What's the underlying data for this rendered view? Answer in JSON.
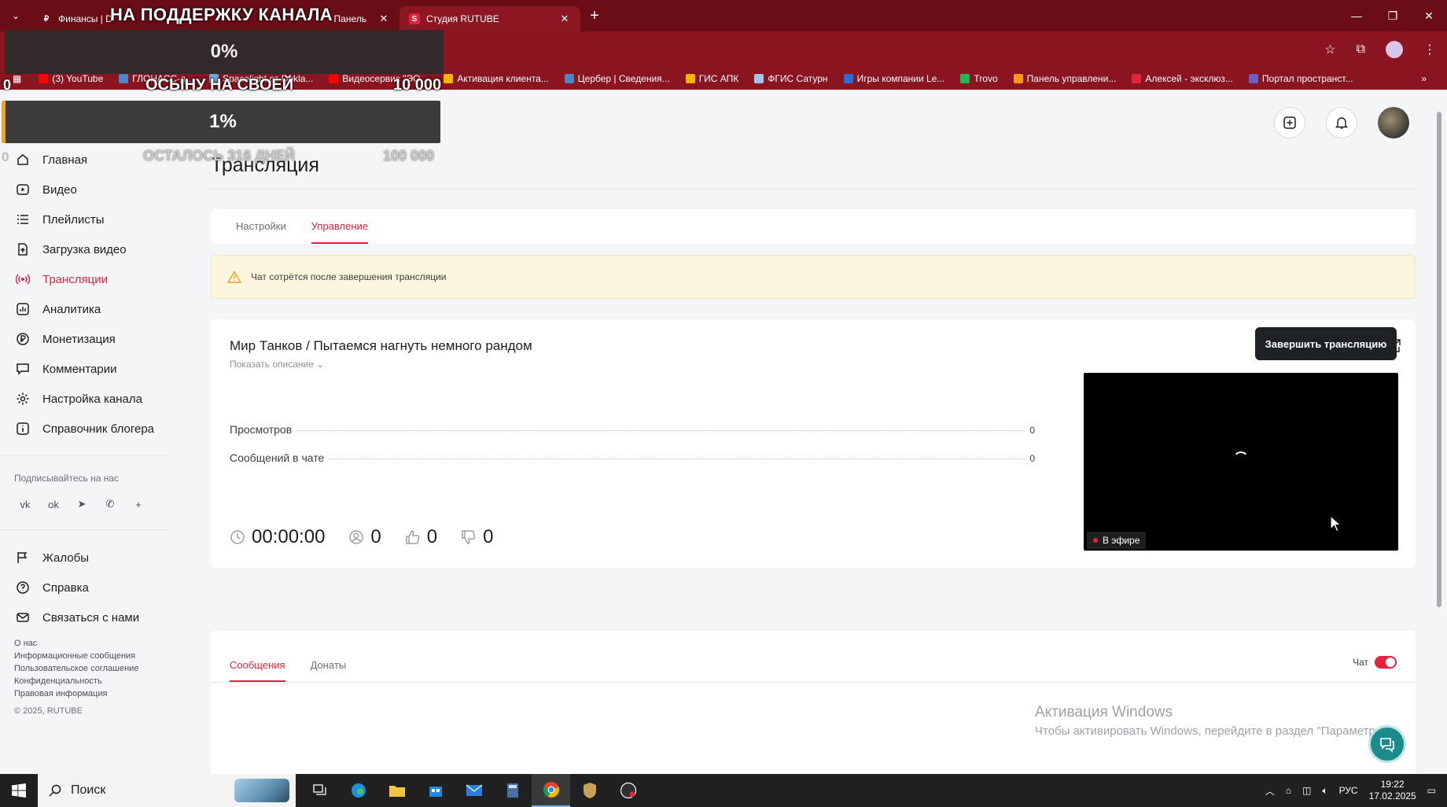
{
  "browser": {
    "tabs": [
      {
        "title": "Финансы | D",
        "title_tail": "Панель",
        "active": false
      },
      {
        "title": "Студия RUTUBE",
        "active": true
      }
    ],
    "new_tab": "+",
    "window_controls": [
      "—",
      "❐",
      "✕"
    ],
    "bookmarks": [
      {
        "label": "(3) YouTube",
        "color": "#ff0000"
      },
      {
        "label": "ГЛОНАСС-д...",
        "color": "#4a86c8"
      },
      {
        "label": "Spacelight от Dokla...",
        "color": "#6fa8dc"
      },
      {
        "label": "Видеосервис \"ЭО...",
        "color": "#ff0000"
      },
      {
        "label": "Активация клиента...",
        "color": "#f4b400"
      },
      {
        "label": "Цербер | Сведения...",
        "color": "#4a86c8"
      },
      {
        "label": "ГИС АПК",
        "color": "#f4b400"
      },
      {
        "label": "ФГИС Сатурн",
        "color": "#9fc5e8"
      },
      {
        "label": "Игры компании Le...",
        "color": "#2d6cdf"
      },
      {
        "label": "Trovo",
        "color": "#1db954"
      },
      {
        "label": "Панель управлени...",
        "color": "#f29b1d"
      },
      {
        "label": "Алексей - эксклюз...",
        "color": "#e2233e"
      },
      {
        "label": "Портал пространст...",
        "color": "#6d5ec9"
      }
    ],
    "bookmarks_more": "»"
  },
  "overlay": {
    "title": "НА ПОДДЕРЖКУ КАНАЛА",
    "goal1": {
      "percent": "0%",
      "min": "0",
      "subtitle": "ОСЫНУ НА СВОЕЙ",
      "max": "10 000",
      "progress": 0.0
    },
    "goal2": {
      "percent": "1%",
      "min": "0",
      "subtitle": "ОСТАЛОСЬ 316 ДНЕЙ",
      "max": "100 000",
      "progress": 0.01
    }
  },
  "sidebar": {
    "items": [
      {
        "label": "Главная",
        "icon": "home-icon",
        "active": false
      },
      {
        "label": "Видео",
        "icon": "video-icon",
        "active": false
      },
      {
        "label": "Плейлисты",
        "icon": "playlist-icon",
        "active": false
      },
      {
        "label": "Загрузка видео",
        "icon": "upload-icon",
        "active": false
      },
      {
        "label": "Трансляции",
        "icon": "broadcast-icon",
        "active": true
      },
      {
        "label": "Аналитика",
        "icon": "analytics-icon",
        "active": false
      },
      {
        "label": "Монетизация",
        "icon": "ruble-icon",
        "active": false
      },
      {
        "label": "Комментарии",
        "icon": "comment-icon",
        "active": false
      },
      {
        "label": "Настройка канала",
        "icon": "gear-icon",
        "active": false
      },
      {
        "label": "Справочник блогера",
        "icon": "info-icon",
        "active": false
      }
    ],
    "follow_label": "Подписывайтесь на нас",
    "socials": [
      "vk",
      "ok",
      "telegram",
      "viber",
      "more"
    ],
    "bottom_items": [
      {
        "label": "Жалобы",
        "icon": "flag-icon"
      },
      {
        "label": "Справка",
        "icon": "help-icon"
      },
      {
        "label": "Связаться с нами",
        "icon": "mail-icon"
      }
    ],
    "footer_links": [
      "О нас",
      "Информационные сообщения",
      "Пользовательское соглашение",
      "Конфиденциальность",
      "Правовая информация"
    ],
    "copyright": "© 2025, RUTUBE"
  },
  "page": {
    "title": "Трансляция",
    "tabs": [
      {
        "label": "Настройки",
        "active": false
      },
      {
        "label": "Управление",
        "active": true
      }
    ],
    "alert": "Чат сотрётся после завершения трансляции",
    "stream": {
      "title": "Мир Танков / Пытаемся нагнуть немного рандом",
      "show_description": "Показать описание",
      "stats": [
        {
          "label": "Просмотров",
          "value": "0"
        },
        {
          "label": "Сообщений в чате",
          "value": "0"
        }
      ],
      "duration": "00:00:00",
      "viewers": "0",
      "likes": "0",
      "dislikes": "0",
      "live_badge": "В эфире",
      "end_button": "Завершить трансляцию"
    },
    "chat": {
      "tabs": [
        {
          "label": "Сообщения",
          "active": true
        },
        {
          "label": "Донаты",
          "active": false
        }
      ],
      "toggle_label": "Чат",
      "toggle_on": true
    }
  },
  "watermark": {
    "line1": "Активация Windows",
    "line2": "Чтобы активировать Windows, перейдите в раздел \"Параметры\""
  },
  "taskbar": {
    "search": "Поиск",
    "language": "РУС",
    "time": "19:22",
    "date": "17.02.2025"
  },
  "colors": {
    "accent": "#e2233e",
    "tabbar": "#6b0d17",
    "toolbar": "#8a1420"
  }
}
